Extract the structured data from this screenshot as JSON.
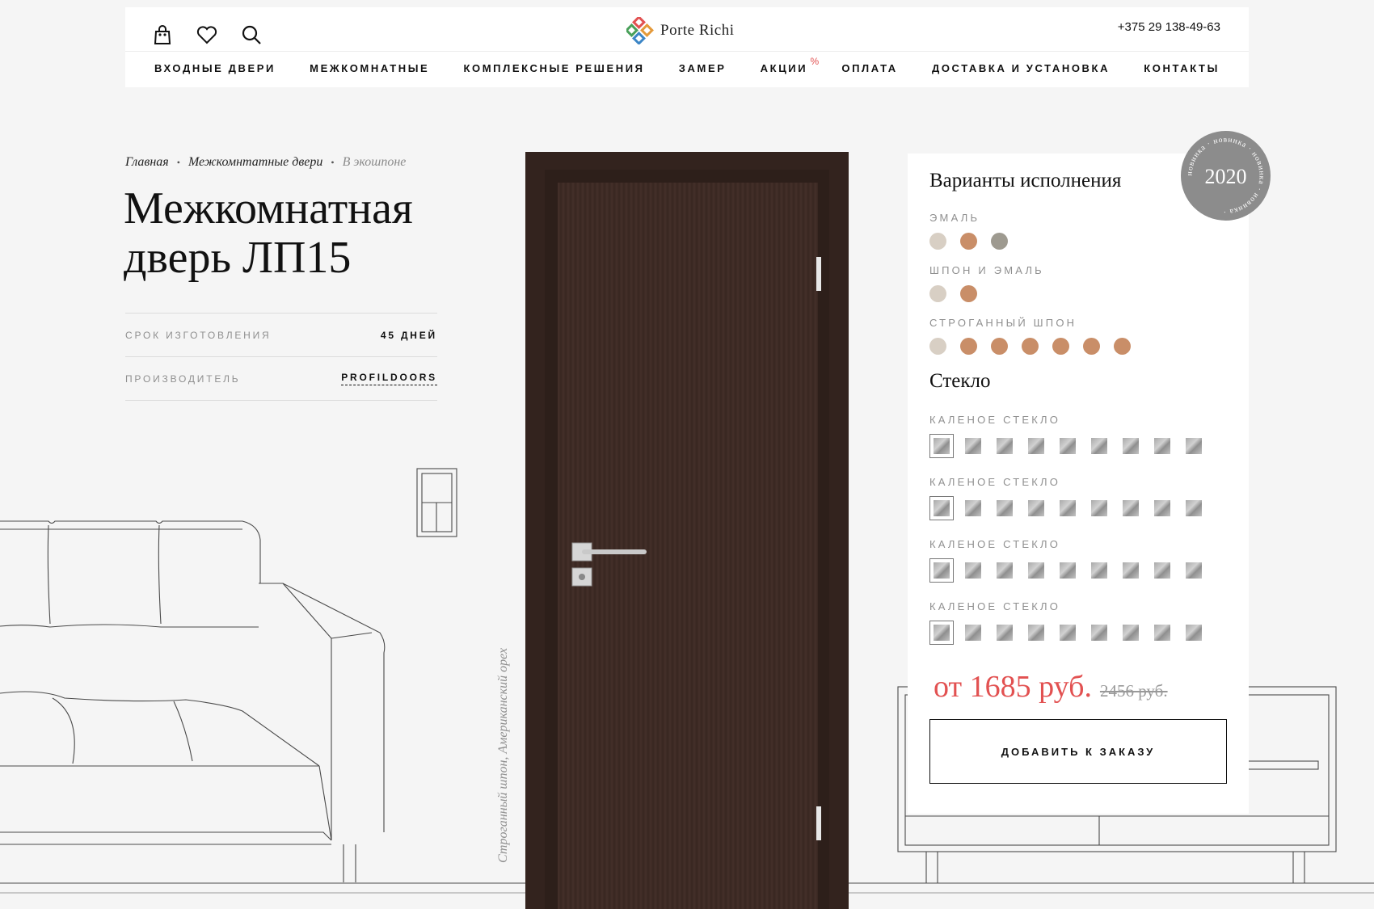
{
  "header": {
    "brand_logo": "Porte Richi",
    "phone": "+375 29 138-49-63",
    "icons": [
      "bag-icon",
      "heart-icon",
      "search-icon"
    ],
    "nav": [
      {
        "label": "ВХОДНЫЕ ДВЕРИ"
      },
      {
        "label": "МЕЖКОМНАТНЫЕ"
      },
      {
        "label": "КОМПЛЕКСНЫЕ РЕШЕНИЯ"
      },
      {
        "label": "ЗАМЕР"
      },
      {
        "label": "АКЦИИ",
        "sup": "%"
      },
      {
        "label": "ОПЛАТА"
      },
      {
        "label": "ДОСТАВКА И УСТАНОВКА"
      },
      {
        "label": "КОНТАКТЫ"
      }
    ]
  },
  "breadcrumb": {
    "items": [
      "Главная",
      "Межкомнтатные двери"
    ],
    "current": "В экошпоне"
  },
  "product": {
    "title": "Межкомнатная дверь ЛП15",
    "specs": [
      {
        "label": "СРОК ИЗГОТОВЛЕНИЯ",
        "value": "45 ДНЕЙ"
      },
      {
        "label": "ПРОИЗВОДИТЕЛЬ",
        "value": "PROFILDOORS"
      }
    ],
    "door_caption": "Строганный шпон, Американский орех"
  },
  "options": {
    "title": "Варианты исполнения",
    "groups": [
      {
        "label": "ЭМАЛЬ",
        "colors": [
          "#d8cfc4",
          "#c98e68",
          "#9e9a90"
        ]
      },
      {
        "label": "ШПОН И ЭМАЛЬ",
        "colors": [
          "#d8cfc4",
          "#c98e68"
        ]
      },
      {
        "label": "СТРОГАННЫЙ ШПОН",
        "colors": [
          "#d8cfc4",
          "#c98e68",
          "#c98e68",
          "#c98e68",
          "#c98e68",
          "#c98e68",
          "#c98e68"
        ]
      }
    ]
  },
  "glass": {
    "title": "Стекло",
    "groups": [
      {
        "label": "КАЛЕНОЕ СТЕКЛО",
        "count": 9
      },
      {
        "label": "КАЛЕНОЕ СТЕКЛО",
        "count": 9
      },
      {
        "label": "КАЛЕНОЕ СТЕКЛО",
        "count": 9
      },
      {
        "label": "КАЛЕНОЕ СТЕКЛО",
        "count": 9
      }
    ]
  },
  "price": {
    "current": "от 1685 руб.",
    "old": "2456 руб."
  },
  "cta": {
    "label": "ДОБАВИТЬ К ЗАКАЗУ"
  },
  "badge": {
    "year": "2020",
    "ring_text": "новинка · новинка · новинка · новинка ·"
  },
  "colors": {
    "accent_red": "#e25151",
    "door": "#3e2b25"
  }
}
